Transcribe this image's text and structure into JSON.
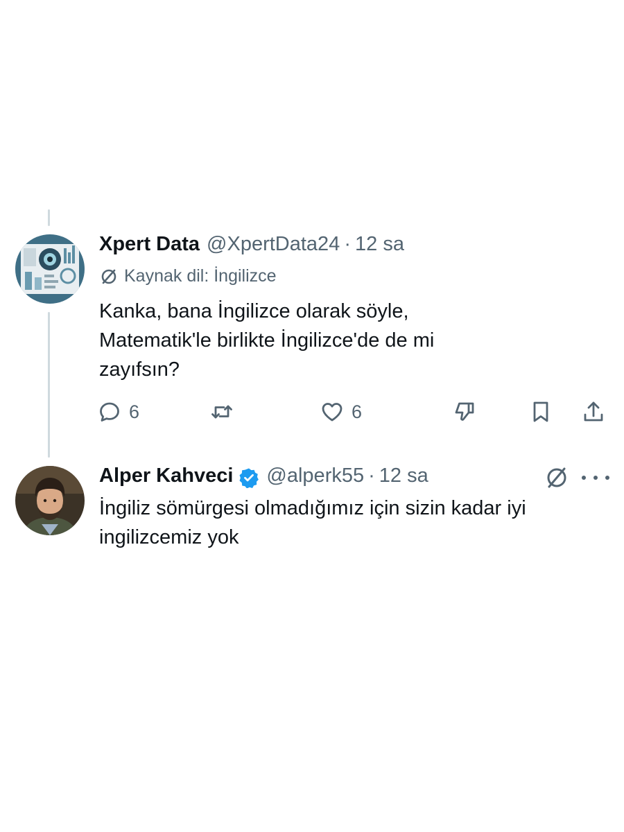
{
  "tweets": [
    {
      "display_name": "Xpert Data",
      "handle": "@XpertData24",
      "separator": "·",
      "time": "12 sa",
      "source_lang": "Kaynak dil: İngilizce",
      "text": "Kanka, bana İngilizce olarak söyle, Matematik'le birlikte İngilizce'de de mi zayıfsın?",
      "actions": {
        "replies": "6",
        "likes": "6"
      }
    },
    {
      "display_name": "Alper Kahveci",
      "verified": true,
      "handle": "@alperk55",
      "separator": "·",
      "time": "12 sa",
      "text": "İngiliz sömürgesi olmadığımız için sizin kadar iyi ingilizcemiz yok"
    }
  ],
  "icons": {
    "reply": "reply-icon",
    "retweet": "retweet-icon",
    "like": "heart-icon",
    "dislike": "thumbs-down-icon",
    "bookmark": "bookmark-icon",
    "share": "share-icon",
    "translate": "translate-off-icon",
    "more": "more-icon",
    "verified": "verified-badge-icon"
  },
  "colors": {
    "text": "#0f1419",
    "secondary": "#536471",
    "verified": "#1d9bf0",
    "thread_line": "#cfd9de"
  }
}
